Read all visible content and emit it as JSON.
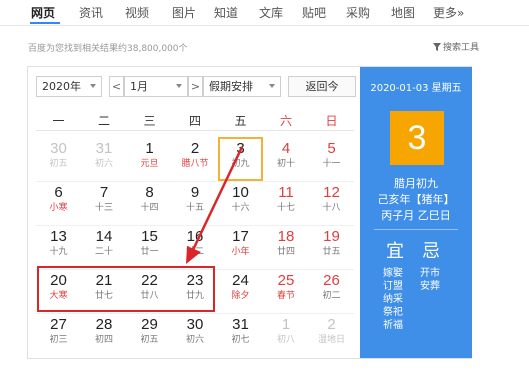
{
  "tabs": [
    {
      "label": "网页",
      "active": true
    },
    {
      "label": "资讯"
    },
    {
      "label": "视频"
    },
    {
      "label": "图片"
    },
    {
      "label": "知道"
    },
    {
      "label": "文库"
    },
    {
      "label": "贴吧"
    },
    {
      "label": "采购"
    },
    {
      "label": "地图"
    },
    {
      "label": "更多»"
    }
  ],
  "result_count": "百度为您找到相关结果约38,800,000个",
  "search_tools": "搜索工具",
  "calendar": {
    "year_select": "2020年",
    "prev": "<",
    "month_select": "1月",
    "next": ">",
    "holiday_select": "假期安排",
    "today_button": "返回今",
    "weekdays": [
      "一",
      "二",
      "三",
      "四",
      "五",
      "六",
      "日"
    ],
    "weeks": [
      [
        {
          "d": "30",
          "l": "初五",
          "other": true
        },
        {
          "d": "31",
          "l": "初六",
          "other": true
        },
        {
          "d": "1",
          "l": "元旦",
          "fest": true
        },
        {
          "d": "2",
          "l": "腊八节",
          "fest": true
        },
        {
          "d": "3",
          "l": "初九",
          "selected": true
        },
        {
          "d": "4",
          "l": "初十",
          "wknd": true
        },
        {
          "d": "5",
          "l": "十一",
          "wknd": true
        }
      ],
      [
        {
          "d": "6",
          "l": "小寒",
          "fest": true
        },
        {
          "d": "7",
          "l": "十三"
        },
        {
          "d": "8",
          "l": "十四"
        },
        {
          "d": "9",
          "l": "十五"
        },
        {
          "d": "10",
          "l": "十六"
        },
        {
          "d": "11",
          "l": "十七",
          "wknd": true
        },
        {
          "d": "12",
          "l": "十八",
          "wknd": true
        }
      ],
      [
        {
          "d": "13",
          "l": "十九"
        },
        {
          "d": "14",
          "l": "二十"
        },
        {
          "d": "15",
          "l": "廿一"
        },
        {
          "d": "16",
          "l": "廿二"
        },
        {
          "d": "17",
          "l": "小年",
          "fest": true
        },
        {
          "d": "18",
          "l": "廿四",
          "wknd": true
        },
        {
          "d": "19",
          "l": "廿五",
          "wknd": true
        }
      ],
      [
        {
          "d": "20",
          "l": "大寒",
          "fest": true
        },
        {
          "d": "21",
          "l": "廿七"
        },
        {
          "d": "22",
          "l": "廿八"
        },
        {
          "d": "23",
          "l": "廿九"
        },
        {
          "d": "24",
          "l": "除夕",
          "fest": true
        },
        {
          "d": "25",
          "l": "春节",
          "wknd": true,
          "fest": true
        },
        {
          "d": "26",
          "l": "初二",
          "wknd": true
        }
      ],
      [
        {
          "d": "27",
          "l": "初三"
        },
        {
          "d": "28",
          "l": "初四"
        },
        {
          "d": "29",
          "l": "初五"
        },
        {
          "d": "30",
          "l": "初六"
        },
        {
          "d": "31",
          "l": "初七"
        },
        {
          "d": "1",
          "l": "初八",
          "other": true
        },
        {
          "d": "2",
          "l": "湿地日",
          "other": true
        }
      ]
    ]
  },
  "panel": {
    "date": "2020-01-03 星期五",
    "day": "3",
    "lunar": "腊月初九",
    "year_gz": "己亥年【猪年】",
    "month_day_gz": "丙子月 乙巳日",
    "yi_label": "宜",
    "ji_label": "忌",
    "yi_items": [
      "嫁娶",
      "订盟",
      "纳采",
      "祭祀",
      "祈福"
    ],
    "ji_items": [
      "开市",
      "安葬"
    ]
  },
  "colors": {
    "panel_bg": "#3f8fe8",
    "day_box": "#f7a500",
    "weekend_red": "#e03e3e",
    "selected_border": "#f2b23a",
    "annotation_red": "#d9262a",
    "tab_accent": "#3385ff"
  }
}
